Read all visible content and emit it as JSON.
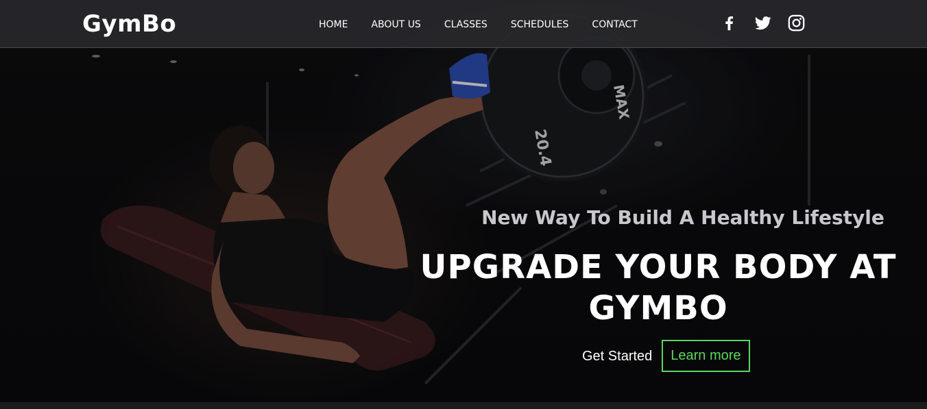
{
  "brand": {
    "logo_text": "GymBo"
  },
  "nav": {
    "items": [
      {
        "label": "HOME"
      },
      {
        "label": "ABOUT US"
      },
      {
        "label": "CLASSES"
      },
      {
        "label": "SCHEDULES"
      },
      {
        "label": "CONTACT"
      }
    ]
  },
  "social": {
    "icons": [
      "facebook-icon",
      "twitter-icon",
      "instagram-icon"
    ]
  },
  "hero": {
    "tagline": "New Way To Build A Healthy Lifestyle",
    "headline_line1": "UPGRADE YOUR BODY AT",
    "headline_line2": "GYMBO",
    "get_started_label": "Get Started",
    "learn_more_label": "Learn more",
    "plate_label": "20.4",
    "plate_brand": "MAX"
  },
  "colors": {
    "accent": "#5cd65c",
    "navbar_bg": "#28282b",
    "text": "#ffffff",
    "tagline": "#c8c8cc",
    "hero_bg": "#0b0b0d"
  }
}
